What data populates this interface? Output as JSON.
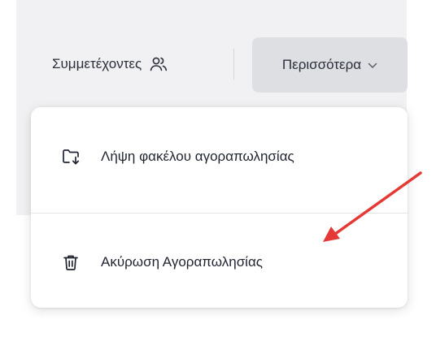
{
  "header": {
    "participants_label": "Συμμετέχοντες",
    "more_label": "Περισσότερα"
  },
  "menu": {
    "items": [
      {
        "label": "Λήψη φακέλου αγοραπωλησίας",
        "icon": "folder-download-icon"
      },
      {
        "label": "Ακύρωση Αγοραπωλησίας",
        "icon": "trash-icon"
      }
    ]
  },
  "colors": {
    "background": "#f1f1f3",
    "button_background": "#dedfe3",
    "annotation_arrow": "#e53935"
  }
}
